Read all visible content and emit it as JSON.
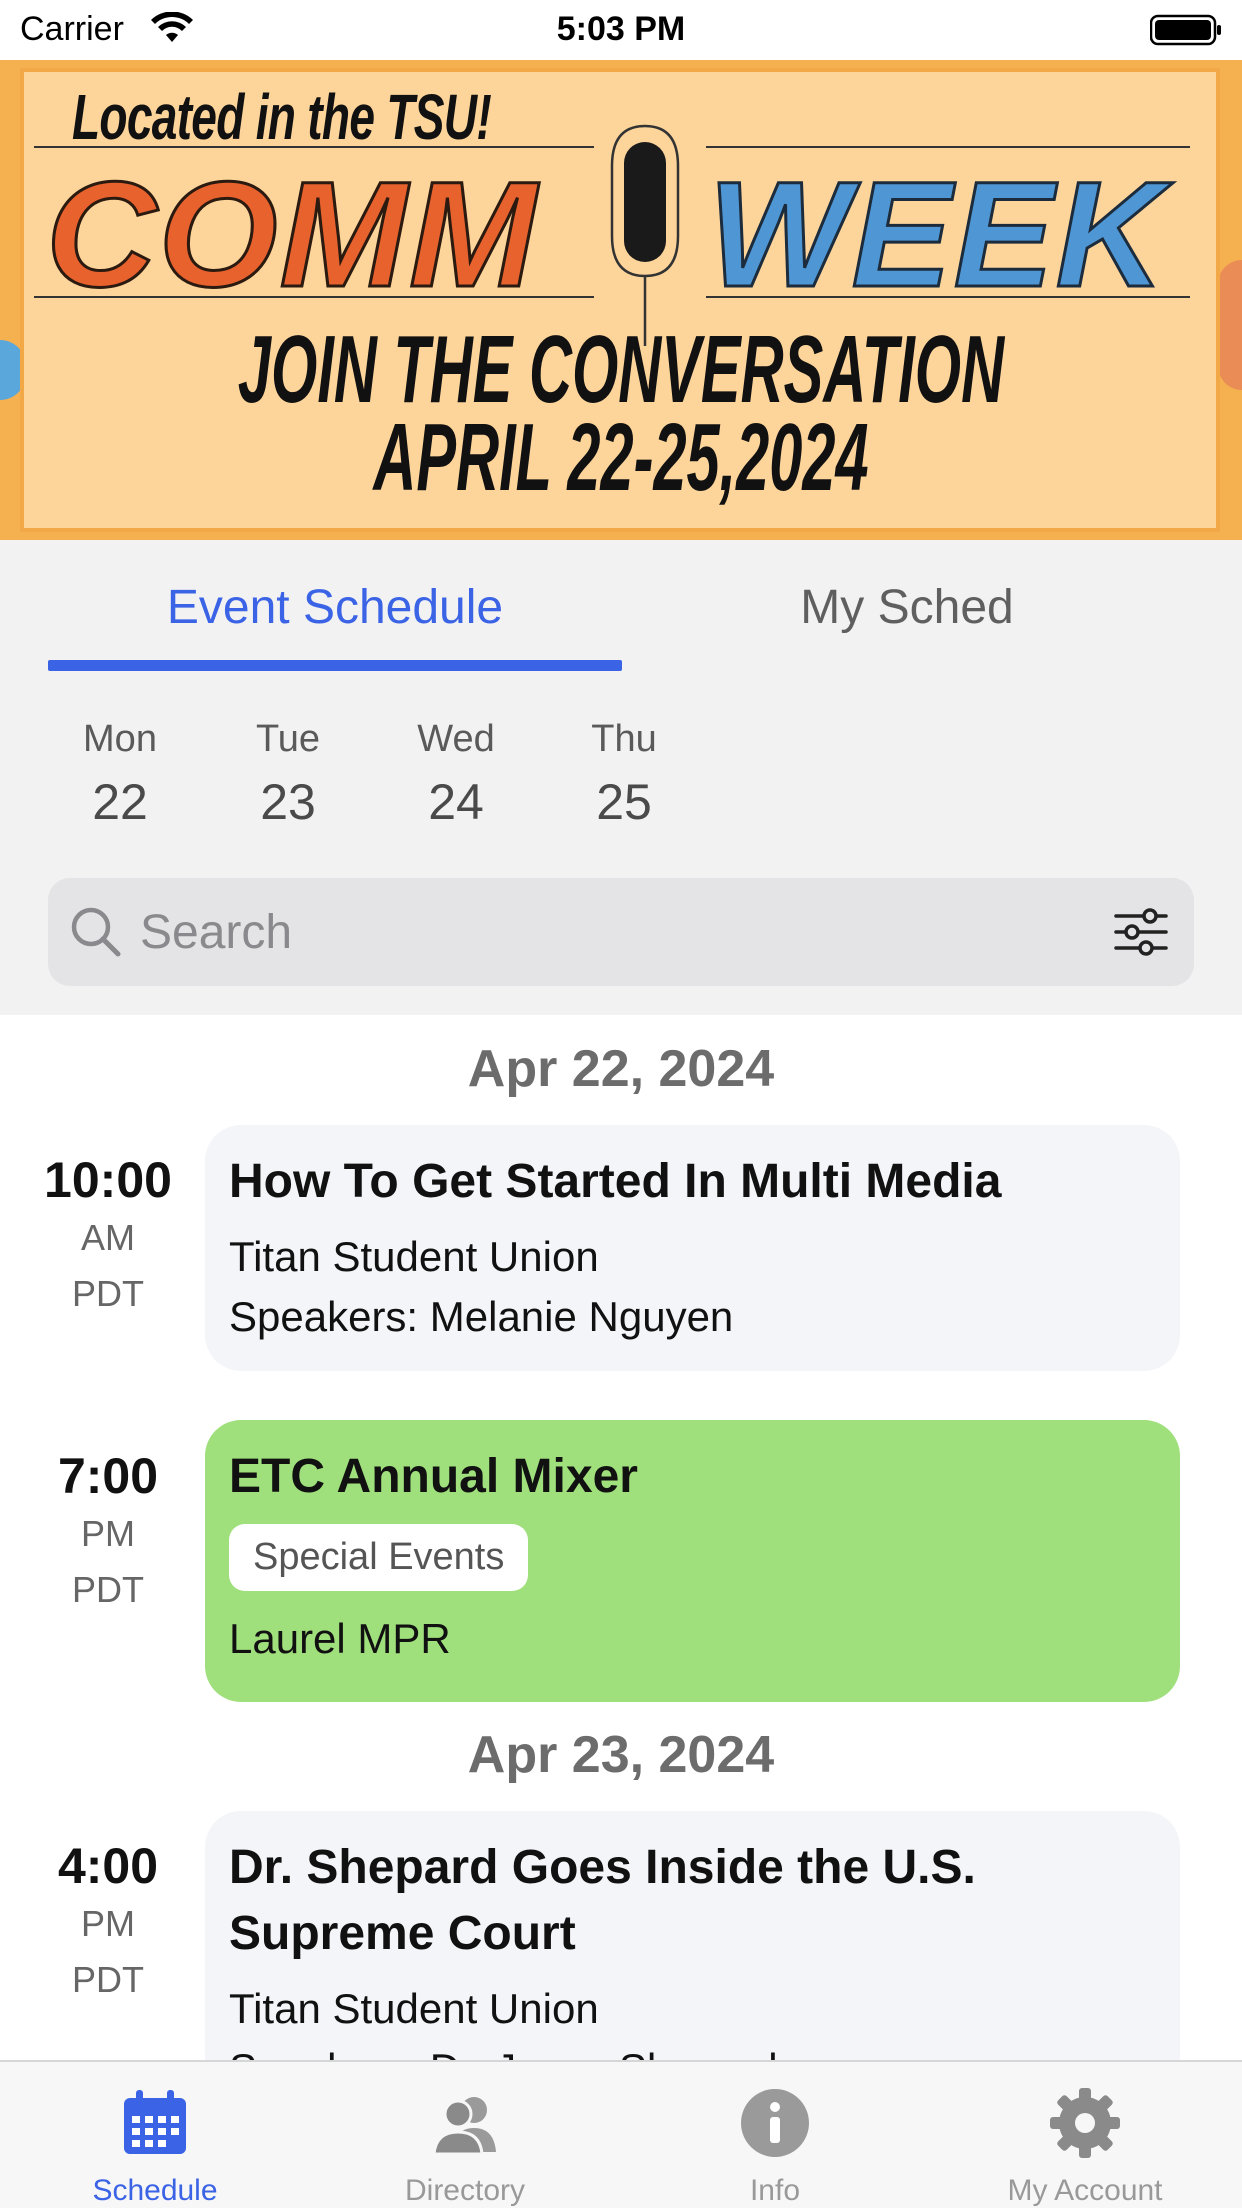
{
  "status_bar": {
    "carrier": "Carrier",
    "time": "5:03 PM",
    "wifi_icon": "wifi-icon",
    "battery_icon": "battery-icon"
  },
  "banner": {
    "located": "Located in the TSU!",
    "word_left": "COMM",
    "word_right": "WEEK",
    "tagline": "JOIN THE CONVERSATION",
    "dates": "APRIL 22-25,2024",
    "colors": {
      "background": "#fdd59b",
      "comm": "#e8622e",
      "week": "#4f97d4"
    }
  },
  "tabs": [
    {
      "label": "Event Schedule",
      "active": true
    },
    {
      "label": "My Sched",
      "active": false
    }
  ],
  "days": [
    {
      "name": "Mon",
      "num": "22"
    },
    {
      "name": "Tue",
      "num": "23"
    },
    {
      "name": "Wed",
      "num": "24"
    },
    {
      "name": "Thu",
      "num": "25"
    }
  ],
  "search": {
    "placeholder": "Search",
    "value": "",
    "icon": "search-icon",
    "filter_icon": "filter-sliders-icon"
  },
  "schedule": [
    {
      "date": "Apr 22, 2024",
      "events": [
        {
          "time": "10:00",
          "ampm": "AM",
          "tz": "PDT",
          "title": "How To Get Started In Multi Media",
          "location": "Titan Student Union",
          "speakers": "Speakers: Melanie Nguyen"
        },
        {
          "time": "7:00",
          "ampm": "PM",
          "tz": "PDT",
          "title": "ETC Annual Mixer",
          "badge": "Special Events",
          "location": "Laurel MPR",
          "color": "#9fdf7c"
        }
      ]
    },
    {
      "date": "Apr 23, 2024",
      "events": [
        {
          "time": "4:00",
          "ampm": "PM",
          "tz": "PDT",
          "title": "Dr. Shepard Goes Inside the U.S. Supreme Court",
          "location": "Titan Student Union",
          "speakers": "Speakers: Dr. Jason Shepard"
        }
      ]
    }
  ],
  "bottom_nav": [
    {
      "label": "Schedule",
      "icon": "calendar-icon",
      "active": true
    },
    {
      "label": "Directory",
      "icon": "people-icon",
      "active": false
    },
    {
      "label": "Info",
      "icon": "info-icon",
      "active": false
    },
    {
      "label": "My Account",
      "icon": "gear-icon",
      "active": false
    }
  ],
  "colors": {
    "accent": "#3b63e6",
    "card_background": "#f4f5f9",
    "special_event": "#9fdf7c"
  }
}
